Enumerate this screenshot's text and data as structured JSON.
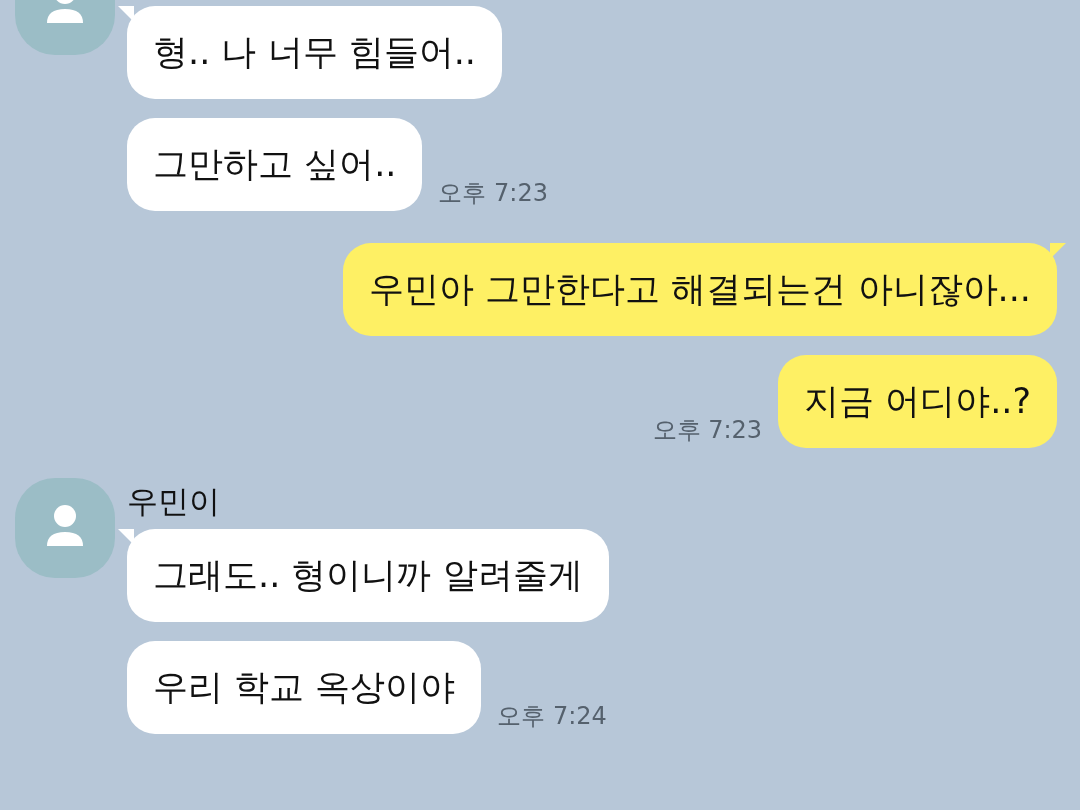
{
  "chat": {
    "groups": [
      {
        "kind": "received",
        "avatar": true,
        "messages": [
          {
            "text": "형.. 나 너무 힘들어.."
          },
          {
            "text": "그만하고 싶어..",
            "time": "오후 7:23"
          }
        ]
      },
      {
        "kind": "sent",
        "messages": [
          {
            "text": "우민아 그만한다고 해결되는건 아니잖아..."
          },
          {
            "text": "지금 어디야..?",
            "time": "오후 7:23"
          }
        ]
      },
      {
        "kind": "received",
        "avatar": true,
        "name": "우민이",
        "messages": [
          {
            "text": "그래도.. 형이니까 알려줄게"
          },
          {
            "text": "우리 학교 옥상이야",
            "time": "오후 7:24"
          }
        ]
      }
    ]
  }
}
